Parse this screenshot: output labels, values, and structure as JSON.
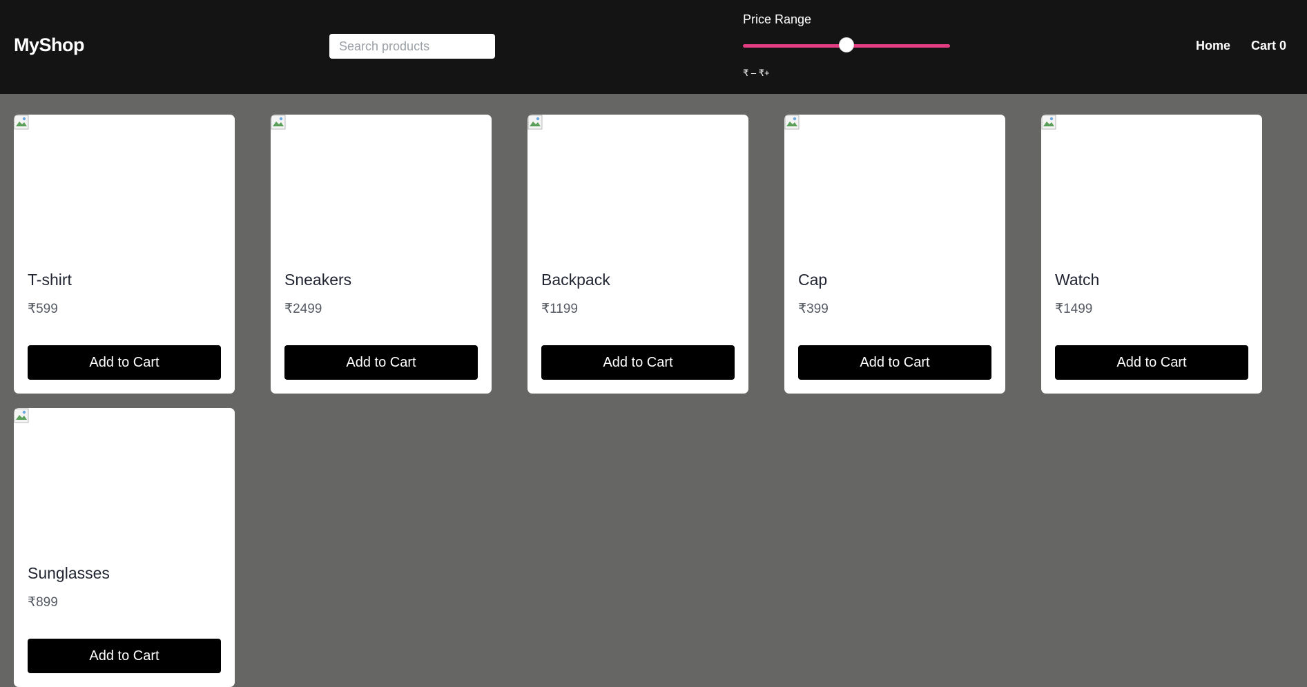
{
  "navbar": {
    "brand": "MyShop",
    "search_placeholder": "Search products",
    "price_range": {
      "title": "Price Range",
      "slider_value_fraction": 0.5,
      "track_color": "#e23c82",
      "readout": "₹ – ₹+"
    },
    "links": [
      {
        "label": "Home"
      },
      {
        "label": "Cart 0"
      }
    ]
  },
  "products": [
    {
      "name": "T-shirt",
      "price": "₹599",
      "button": "Add to Cart"
    },
    {
      "name": "Sneakers",
      "price": "₹2499",
      "button": "Add to Cart"
    },
    {
      "name": "Backpack",
      "price": "₹1199",
      "button": "Add to Cart"
    },
    {
      "name": "Cap",
      "price": "₹399",
      "button": "Add to Cart"
    },
    {
      "name": "Watch",
      "price": "₹1499",
      "button": "Add to Cart"
    },
    {
      "name": "Sunglasses",
      "price": "₹899",
      "button": "Add to Cart"
    }
  ],
  "icons": {
    "product_image": "broken-image-icon"
  }
}
